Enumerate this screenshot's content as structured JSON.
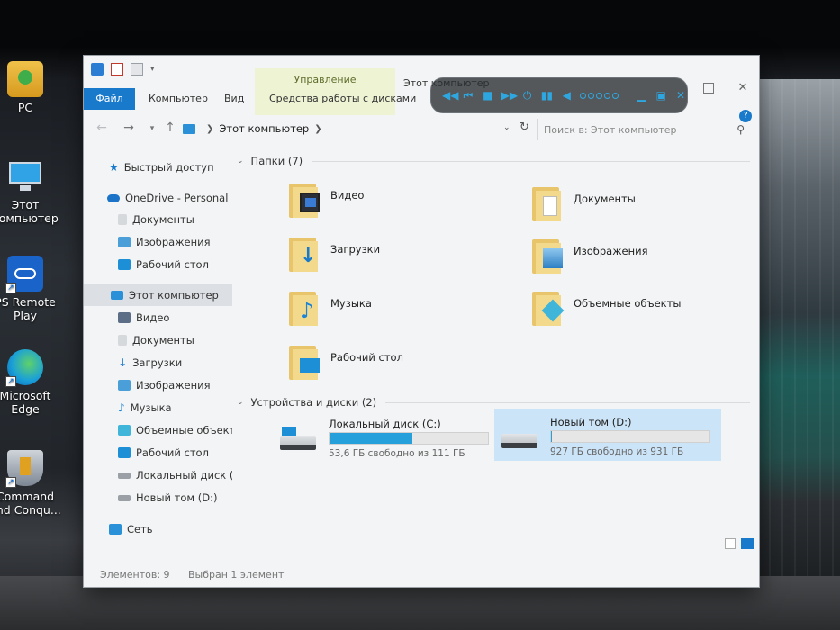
{
  "desktop": {
    "icons": [
      {
        "label": "PC",
        "icon": "user-pc-icon"
      },
      {
        "label": "Этот компьютер",
        "icon": "computer-icon"
      },
      {
        "label": "PS Remote Play",
        "icon": "ps-remote-play-icon"
      },
      {
        "label": "Microsoft Edge",
        "icon": "edge-icon"
      },
      {
        "label": "Command and Conqu...",
        "icon": "command-and-conquer-icon"
      }
    ]
  },
  "window": {
    "title": "Этот компьютер",
    "ribbon_manage_title": "Управление",
    "tabs": {
      "file": "Файл",
      "computer": "Компьютер",
      "view": "Вид",
      "drive_tools": "Средства работы с дисками"
    },
    "address": {
      "path": "Этот компьютер"
    },
    "search": {
      "placeholder": "Поиск в: Этот компьютер"
    },
    "nav": [
      {
        "label": "Быстрый доступ",
        "icon": "star-icon",
        "color": "#1979ca"
      },
      {
        "label": "OneDrive - Personal",
        "icon": "cloud-icon",
        "color": "#1b74c8"
      },
      {
        "label": "Документы",
        "icon": "document-icon",
        "color": "#b9bcc0"
      },
      {
        "label": "Изображения",
        "icon": "image-icon",
        "color": "#4a9fd8"
      },
      {
        "label": "Рабочий стол",
        "icon": "desktop-icon",
        "color": "#1c8fd6"
      },
      {
        "label": "Этот компьютер",
        "icon": "computer-icon",
        "color": "#2a91d8"
      },
      {
        "label": "Видео",
        "icon": "video-icon",
        "color": "#5b6e86"
      },
      {
        "label": "Документы",
        "icon": "document-icon",
        "color": "#b9bcc0"
      },
      {
        "label": "Загрузки",
        "icon": "download-icon",
        "color": "#1979ca"
      },
      {
        "label": "Изображения",
        "icon": "image-icon",
        "color": "#4a9fd8"
      },
      {
        "label": "Музыка",
        "icon": "music-icon",
        "color": "#1b84d6"
      },
      {
        "label": "Объемные объекты",
        "icon": "3d-objects-icon",
        "color": "#3fb6d9"
      },
      {
        "label": "Рабочий стол",
        "icon": "desktop-icon",
        "color": "#1c8fd6"
      },
      {
        "label": "Локальный диск (C:)",
        "icon": "drive-icon",
        "color": "#9aa0a6"
      },
      {
        "label": "Новый том (D:)",
        "icon": "drive-icon",
        "color": "#9aa0a6"
      },
      {
        "label": "Сеть",
        "icon": "network-icon",
        "color": "#2a91d8"
      }
    ],
    "folders_group": "Папки (7)",
    "folders": [
      {
        "label": "Видео",
        "icon": "video-folder-icon"
      },
      {
        "label": "Документы",
        "icon": "documents-folder-icon"
      },
      {
        "label": "Загрузки",
        "icon": "downloads-folder-icon"
      },
      {
        "label": "Изображения",
        "icon": "pictures-folder-icon"
      },
      {
        "label": "Музыка",
        "icon": "music-folder-icon"
      },
      {
        "label": "Объемные объекты",
        "icon": "3d-objects-folder-icon"
      },
      {
        "label": "Рабочий стол",
        "icon": "desktop-folder-icon"
      }
    ],
    "drives_group": "Устройства и диски (2)",
    "drives": [
      {
        "name": "Локальный диск (C:)",
        "free": "53,6 ГБ свободно из 111 ГБ",
        "used_fraction": 0.52,
        "selected": false
      },
      {
        "name": "Новый том (D:)",
        "free": "927 ГБ свободно из 931 ГБ",
        "used_fraction": 0.004,
        "selected": true
      }
    ],
    "status": {
      "count": "Элементов: 9",
      "selected": "Выбран 1 элемент"
    }
  },
  "colors": {
    "accent": "#1979ca",
    "drive_fill": "#26a0da",
    "selection": "#cce4f7"
  }
}
